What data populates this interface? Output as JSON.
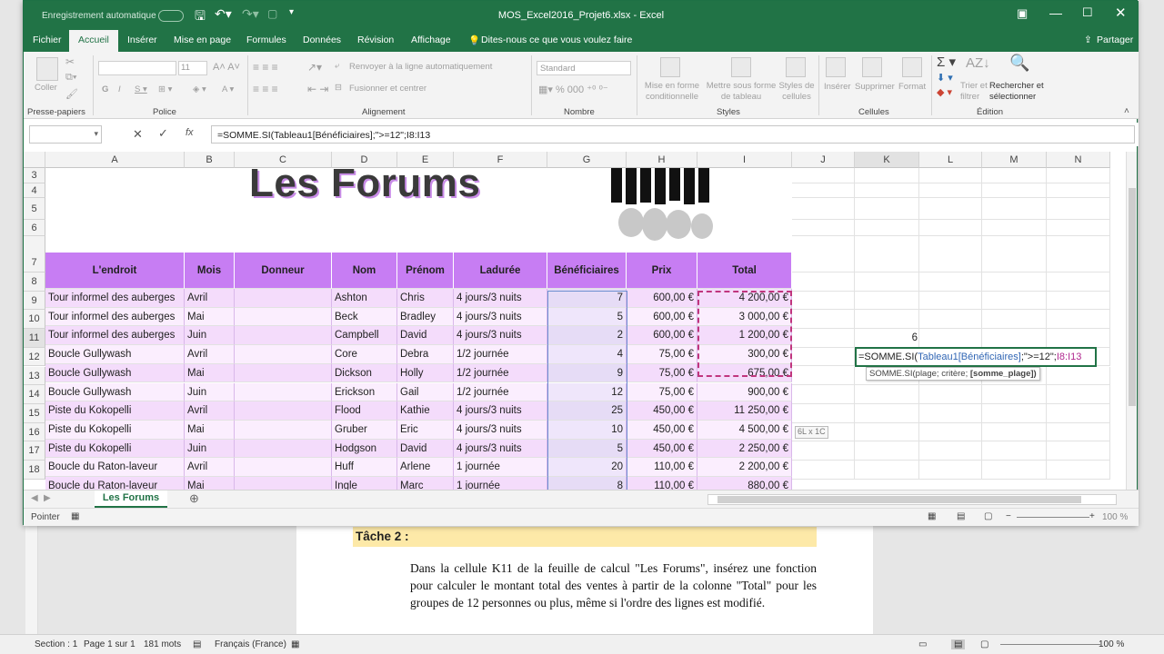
{
  "excel": {
    "autosave_label": "Enregistrement automatique",
    "window_title": "MOS_Excel2016_Projet6.xlsx - Excel",
    "tabs": [
      "Fichier",
      "Accueil",
      "Insérer",
      "Mise en page",
      "Formules",
      "Données",
      "Révision",
      "Affichage"
    ],
    "tell_me": "Dites-nous ce que vous voulez faire",
    "share": "Partager",
    "ribbon": {
      "clipboard": "Presse-papiers",
      "paste": "Coller",
      "font_group": "Police",
      "font_size": "11",
      "alignment_group": "Alignement",
      "wrap_text": "Renvoyer à la ligne automatiquement",
      "merge_center": "Fusionner et centrer",
      "number_group": "Nombre",
      "number_format": "Standard",
      "styles_group": "Styles",
      "cond_format": "Mise en forme conditionnelle",
      "format_table": "Mettre sous forme de tableau",
      "cell_styles": "Styles de cellules",
      "cells_group": "Cellules",
      "insert": "Insérer",
      "delete": "Supprimer",
      "format": "Format",
      "editing_group": "Édition",
      "sort_filter": "Trier et filtrer",
      "find_select": "Rechercher et sélectionner"
    },
    "formula_bar": "=SOMME.SI(Tableau1[Bénéficiaires];\">=12\";I8:I13",
    "columns": [
      "A",
      "B",
      "C",
      "D",
      "E",
      "F",
      "G",
      "H",
      "I",
      "J",
      "K",
      "L",
      "M",
      "N"
    ],
    "title_text": "Les Forums",
    "table_headers": [
      "L'endroit",
      "Mois",
      "Donneur",
      "Nom",
      "Prénom",
      "Ladurée",
      "Bénéficiaires",
      "Prix",
      "Total"
    ],
    "rows": [
      {
        "r": "8",
        "a": "Tour informel des auberges",
        "b": "Avril",
        "d": "Ashton",
        "e": "Chris",
        "f": "4 jours/3 nuits",
        "g": "7",
        "h": "600,00 €",
        "i": "4 200,00 €"
      },
      {
        "r": "9",
        "a": "Tour informel des auberges",
        "b": "Mai",
        "d": "Beck",
        "e": "Bradley",
        "f": "4 jours/3 nuits",
        "g": "5",
        "h": "600,00 €",
        "i": "3 000,00 €"
      },
      {
        "r": "10",
        "a": "Tour informel des auberges",
        "b": "Juin",
        "d": "Campbell",
        "e": "David",
        "f": "4 jours/3 nuits",
        "g": "2",
        "h": "600,00 €",
        "i": "1 200,00 €"
      },
      {
        "r": "11",
        "a": "Boucle Gullywash",
        "b": "Avril",
        "d": "Core",
        "e": "Debra",
        "f": "1/2 journée",
        "g": "4",
        "h": "75,00 €",
        "i": "300,00 €"
      },
      {
        "r": "12",
        "a": "Boucle Gullywash",
        "b": "Mai",
        "d": "Dickson",
        "e": "Holly",
        "f": "1/2 journée",
        "g": "9",
        "h": "75,00 €",
        "i": "675,00 €"
      },
      {
        "r": "13",
        "a": "Boucle Gullywash",
        "b": "Juin",
        "d": "Erickson",
        "e": "Gail",
        "f": "1/2 journée",
        "g": "12",
        "h": "75,00 €",
        "i": "900,00 €"
      },
      {
        "r": "14",
        "a": "Piste du Kokopelli",
        "b": "Avril",
        "d": "Flood",
        "e": "Kathie",
        "f": "4 jours/3 nuits",
        "g": "25",
        "h": "450,00 €",
        "i": "11 250,00 €"
      },
      {
        "r": "15",
        "a": "Piste du Kokopelli",
        "b": "Mai",
        "d": "Gruber",
        "e": "Eric",
        "f": "4 jours/3 nuits",
        "g": "10",
        "h": "450,00 €",
        "i": "4 500,00 €"
      },
      {
        "r": "16",
        "a": "Piste du Kokopelli",
        "b": "Juin",
        "d": "Hodgson",
        "e": "David",
        "f": "4 jours/3 nuits",
        "g": "5",
        "h": "450,00 €",
        "i": "2 250,00 €"
      },
      {
        "r": "17",
        "a": "Boucle du Raton-laveur",
        "b": "Avril",
        "d": "Huff",
        "e": "Arlene",
        "f": "1 journée",
        "g": "20",
        "h": "110,00 €",
        "i": "2 200,00 €"
      },
      {
        "r": "18",
        "a": "Boucle du Raton-laveur",
        "b": "Mai",
        "d": "Ingle",
        "e": "Marc",
        "f": "1 journée",
        "g": "8",
        "h": "110,00 €",
        "i": "880,00 €"
      }
    ],
    "k10_value": "6",
    "k11_edit": {
      "start": "=SOMME.SI(",
      "ref": "Tableau1[Bénéficiaires]",
      "mid": ";\">=12\";",
      "range": "I8:I13"
    },
    "tooltip": {
      "fn": "SOMME.SI(plage; critère; ",
      "opt": "[somme_plage])"
    },
    "size_hint": "6L x 1C",
    "sheet_tab": "Les Forums",
    "status_mode": "Pointer",
    "zoom": "100 %"
  },
  "word": {
    "task_title": "Tâche 2 :",
    "task_body": "Dans la cellule K11 de la feuille de calcul \"Les Forums\", insérez une fonction pour calculer le montant total des ventes à partir de la colonne \"Total\" pour les groupes de 12 personnes ou plus, même si l'ordre des lignes est modifié.",
    "status": {
      "section": "Section : 1",
      "page": "Page 1 sur 1",
      "words": "181 mots",
      "lang": "Français (France)",
      "zoom": "100 %"
    }
  }
}
